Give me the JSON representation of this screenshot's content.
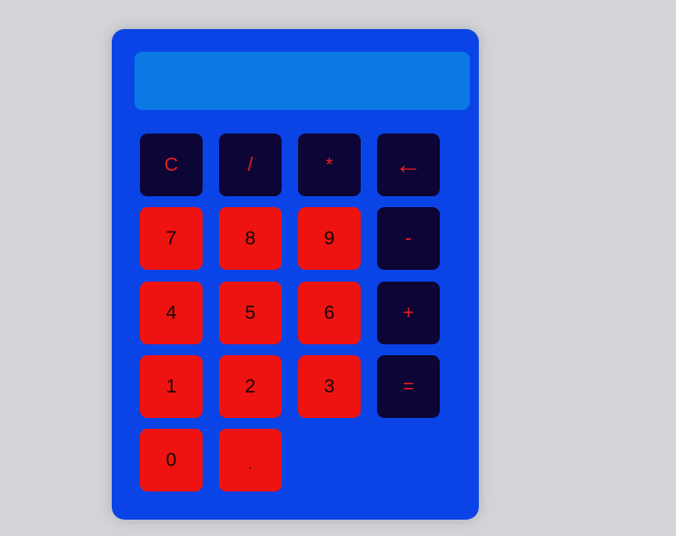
{
  "display": {
    "value": ""
  },
  "keys": {
    "clear": "C",
    "divide": "/",
    "multiply": "*",
    "backspace": "←",
    "seven": "7",
    "eight": "8",
    "nine": "9",
    "minus": "-",
    "four": "4",
    "five": "5",
    "six": "6",
    "plus": "+",
    "one": "1",
    "two": "2",
    "three": "3",
    "equals": "=",
    "zero": "0",
    "decimal": "."
  },
  "colors": {
    "page_background": "#d3d4d8",
    "calculator_body": "#0b44e6",
    "display_background": "#0b78e4",
    "operator_key_background": "#0c0535",
    "operator_key_text": "#ee1c22",
    "number_key_background": "#ee1311",
    "number_key_text": "#120707"
  }
}
